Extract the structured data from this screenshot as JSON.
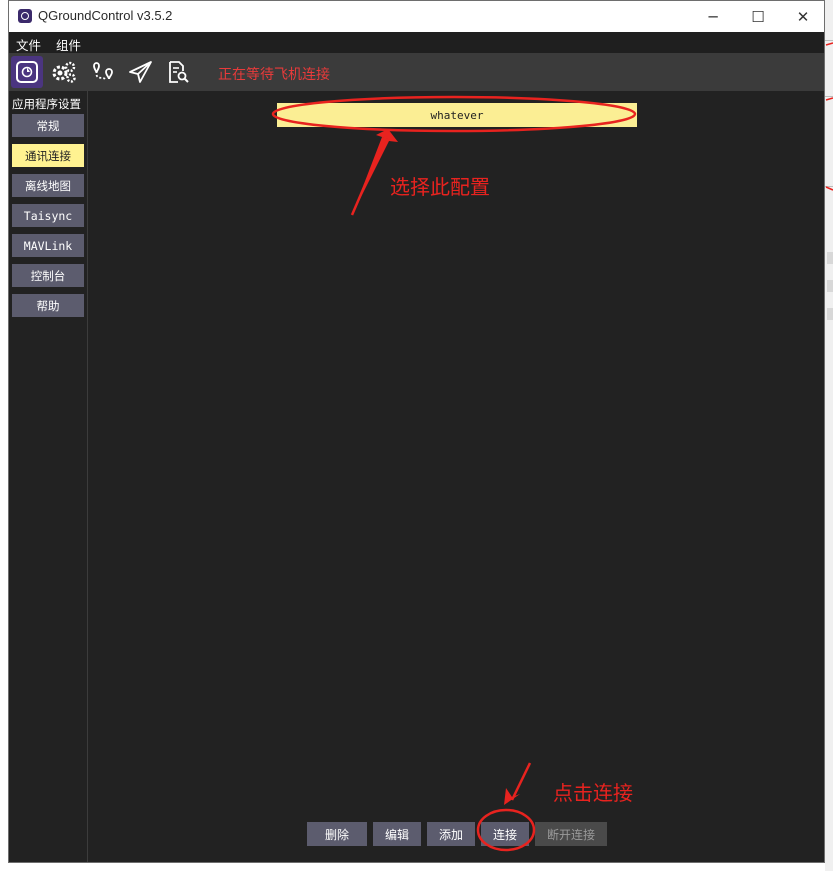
{
  "window": {
    "title": "QGroundControl v3.5.2",
    "controls": {
      "minimize": "─",
      "maximize": "☐",
      "close": "✕"
    }
  },
  "menubar": {
    "items": [
      "文件",
      "组件"
    ]
  },
  "toolbar": {
    "icons": [
      "qgc-logo-icon",
      "gears-icon",
      "route-icon",
      "paper-plane-icon",
      "analyze-icon"
    ],
    "status": "正在等待飞机连接",
    "status_color": "#e83b3b"
  },
  "sidebar": {
    "heading": "应用程序设置",
    "items": [
      "常规",
      "通讯连接",
      "离线地图",
      "Taisync",
      "MAVLink",
      "控制台",
      "帮助"
    ],
    "selected": "通讯连接"
  },
  "links": {
    "items": [
      "whatever"
    ],
    "selected": "whatever"
  },
  "buttons": {
    "delete": "删除",
    "edit": "编辑",
    "add": "添加",
    "connect": "连接",
    "disconnect": "断开连接"
  },
  "annotations": {
    "select_config": "选择此配置",
    "click_connect": "点击连接",
    "color": "#e8231f"
  },
  "colors": {
    "background": "#222222",
    "button": "#5c5c6e",
    "selected": "#fff291",
    "toolbar": "#3b3b3b",
    "accent": "#4b3580"
  }
}
